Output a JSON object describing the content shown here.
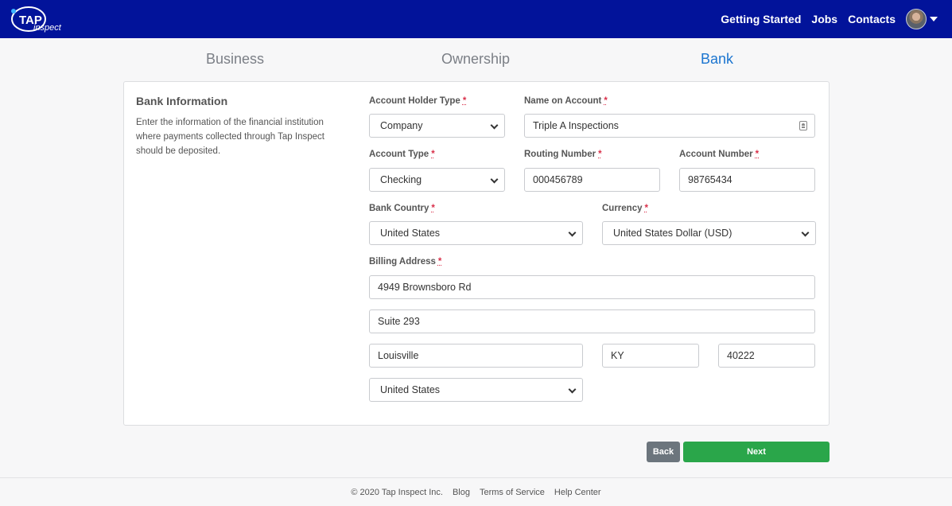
{
  "brand": {
    "logo_text": "TAP",
    "logo_sub": "inspect"
  },
  "nav": {
    "items": [
      "Getting Started",
      "Jobs",
      "Contacts"
    ]
  },
  "steps": [
    "Business",
    "Ownership",
    "Bank"
  ],
  "section": {
    "title": "Bank Information",
    "description": "Enter the information of the financial institution where payments collected through Tap Inspect should be deposited."
  },
  "form": {
    "account_holder_type": {
      "label": "Account Holder Type",
      "value": "Company"
    },
    "name_on_account": {
      "label": "Name on Account",
      "value": "Triple A Inspections"
    },
    "account_type": {
      "label": "Account Type",
      "value": "Checking"
    },
    "routing_number": {
      "label": "Routing Number",
      "value": "000456789"
    },
    "account_number": {
      "label": "Account Number",
      "value": "98765434"
    },
    "bank_country": {
      "label": "Bank Country",
      "value": "United States"
    },
    "currency": {
      "label": "Currency",
      "value": "United States Dollar (USD)"
    },
    "billing_address": {
      "label": "Billing Address",
      "line1": "4949 Brownsboro Rd",
      "line2": "Suite 293",
      "city": "Louisville",
      "state": "KY",
      "zip": "40222",
      "country": "United States"
    },
    "required_marker": "*"
  },
  "buttons": {
    "back": "Back",
    "next": "Next"
  },
  "footer": {
    "copyright": "© 2020 Tap Inspect Inc.",
    "links": [
      "Blog",
      "Terms of Service",
      "Help Center"
    ]
  },
  "colors": {
    "topbar": "#02139a",
    "active_step": "#1b75d0",
    "next_button": "#2aa64a",
    "back_button": "#6c757d",
    "required": "#d9304a"
  }
}
